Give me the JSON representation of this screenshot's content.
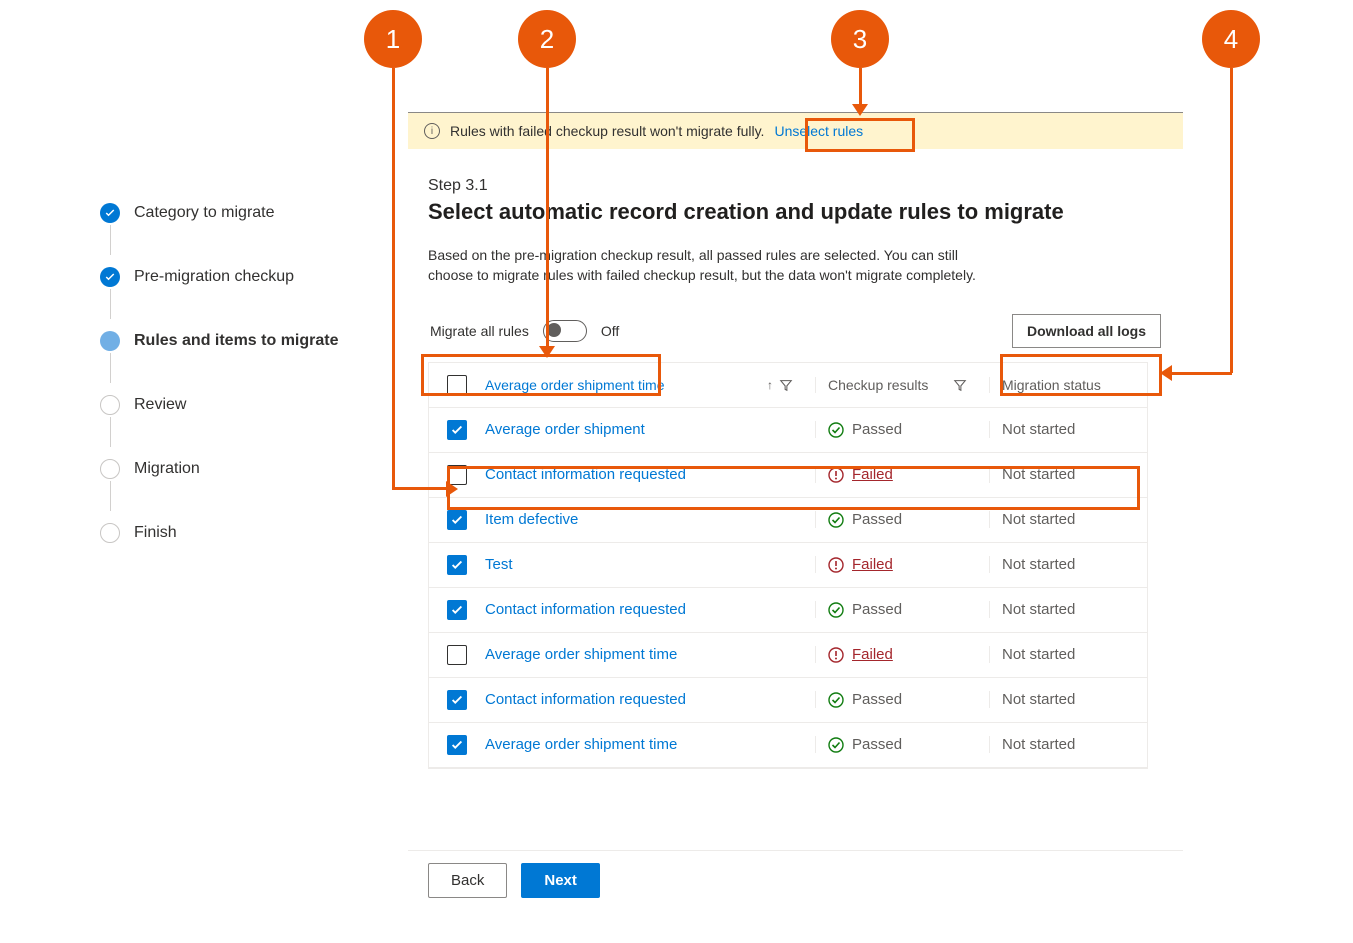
{
  "sidebar": {
    "items": [
      {
        "label": "Category to migrate",
        "state": "done"
      },
      {
        "label": "Pre-migration checkup",
        "state": "done"
      },
      {
        "label": "Rules and items to migrate",
        "state": "current"
      },
      {
        "label": "Review",
        "state": "pending"
      },
      {
        "label": "Migration",
        "state": "pending"
      },
      {
        "label": "Finish",
        "state": "pending"
      }
    ]
  },
  "infoBar": {
    "text": "Rules with failed checkup result won't migrate fully.",
    "link": "Unselect rules"
  },
  "step": {
    "label": "Step 3.1",
    "title": "Select automatic record creation and update rules to migrate",
    "description": "Based on the pre-migration checkup result, all passed rules are selected. You can still choose to migrate rules with failed checkup result, but the data won't migrate completely."
  },
  "toolbar": {
    "toggleLabel": "Migrate all rules",
    "toggleState": "Off",
    "downloadBtn": "Download all logs"
  },
  "table": {
    "headers": {
      "name": "Average order shipment time",
      "result": "Checkup results",
      "status": "Migration status"
    },
    "rows": [
      {
        "checked": true,
        "name": "Average order shipment",
        "result": "Passed",
        "status": "Not started"
      },
      {
        "checked": false,
        "name": "Contact information requested",
        "result": "Failed",
        "status": "Not started"
      },
      {
        "checked": true,
        "name": "Item defective",
        "result": "Passed",
        "status": "Not started"
      },
      {
        "checked": true,
        "name": "Test",
        "result": "Failed",
        "status": "Not started"
      },
      {
        "checked": true,
        "name": "Contact information requested",
        "result": "Passed",
        "status": "Not started"
      },
      {
        "checked": false,
        "name": "Average order shipment time",
        "result": "Failed",
        "status": "Not started"
      },
      {
        "checked": true,
        "name": "Contact information requested",
        "result": "Passed",
        "status": "Not started"
      },
      {
        "checked": true,
        "name": "Average order shipment time",
        "result": "Passed",
        "status": "Not started"
      }
    ]
  },
  "footer": {
    "back": "Back",
    "next": "Next"
  },
  "callouts": {
    "c1": "1",
    "c2": "2",
    "c3": "3",
    "c4": "4"
  }
}
